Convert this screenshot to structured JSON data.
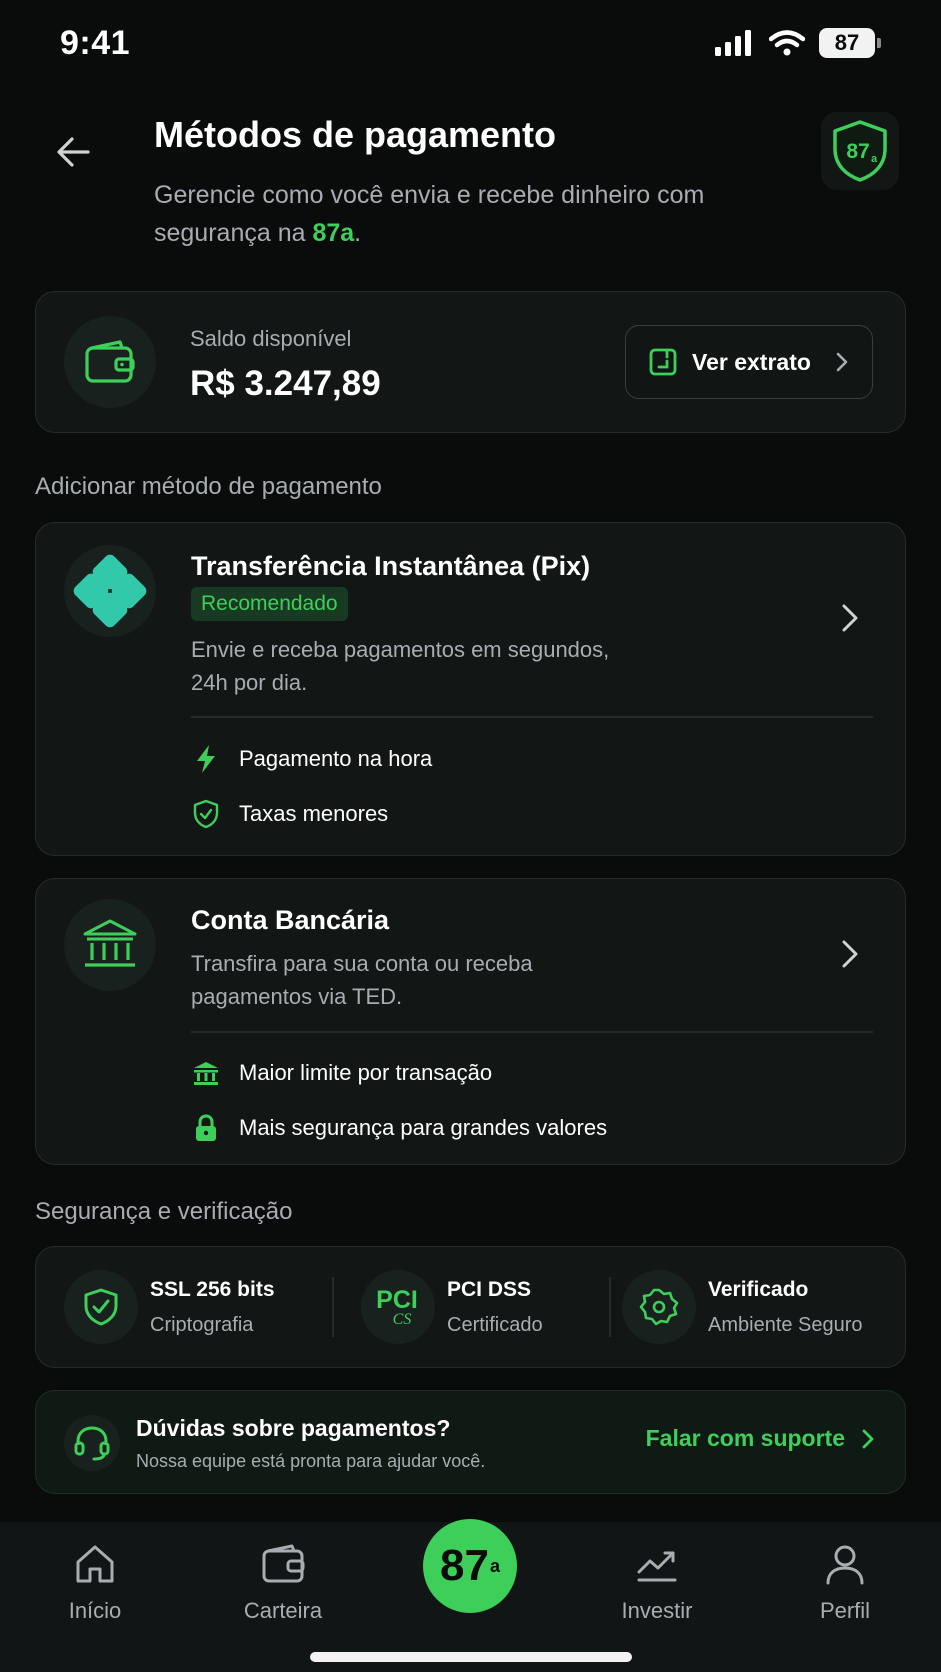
{
  "status_bar": {
    "time": "9:41",
    "battery": "87"
  },
  "header": {
    "title": "Métodos de pagamento",
    "subtitle_prefix": "Gerencie como você envia e recebe dinheiro com segurança na ",
    "subtitle_brand": "87a",
    "subtitle_suffix": ".",
    "logo_text": "87a"
  },
  "balance": {
    "label": "Saldo disponível",
    "value": "R$ 3.247,89",
    "button_label": "Ver extrato"
  },
  "add_method_section_title": "Adicionar método de pagamento",
  "methods": [
    {
      "title": "Transferência Instantânea (Pix)",
      "badge": "Recomendado",
      "description": "Envie e receba pagamentos em segundos, 24h por dia.",
      "features": [
        "Pagamento na hora",
        "Taxas menores"
      ]
    },
    {
      "title": "Conta Bancária",
      "description": "Transfira para sua conta ou receba pagamentos via TED.",
      "features": [
        "Maior limite por transação",
        "Mais segurança para grandes valores"
      ]
    }
  ],
  "security_section_title": "Segurança e verificação",
  "security": [
    {
      "title": "SSL 256 bits",
      "subtitle": "Criptografia",
      "icon": "shield-check-icon"
    },
    {
      "title": "PCI DSS",
      "subtitle": "Certificado",
      "icon": "pci-icon",
      "icon_text": "PCI",
      "icon_subtext": "CS"
    },
    {
      "title": "Verificado",
      "subtitle": "Ambiente Seguro",
      "icon": "verified-badge-icon"
    }
  ],
  "support": {
    "title": "Dúvidas sobre pagamentos?",
    "subtitle": "Nossa equipe está pronta para ajudar você.",
    "link": "Falar com suporte"
  },
  "tabs": [
    {
      "label": "Início",
      "icon": "home-icon"
    },
    {
      "label": "Carteira",
      "icon": "wallet-icon"
    },
    {
      "label": "87a",
      "icon": "brand-icon"
    },
    {
      "label": "Investir",
      "icon": "chart-icon"
    },
    {
      "label": "Perfil",
      "icon": "user-icon"
    }
  ],
  "colors": {
    "accent": "#3ecf5b",
    "pix": "#32c8aa",
    "background": "#0a0c0c",
    "card": "#121615"
  }
}
